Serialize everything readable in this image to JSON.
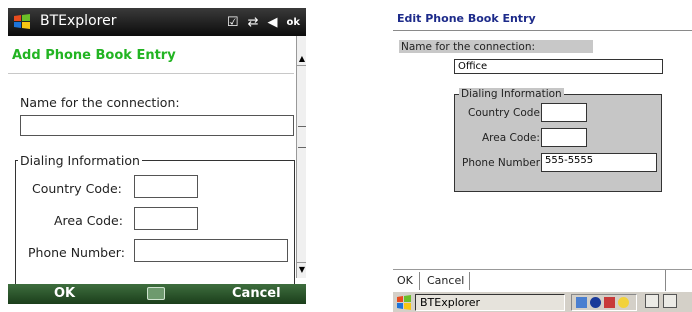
{
  "wm": {
    "title": "BTExplorer",
    "tray": {
      "ok": "ok"
    },
    "heading": "Add Phone Book Entry",
    "name_label": "Name for the connection:",
    "name_value": "",
    "group_legend": "Dialing Information",
    "country_label": "Country Code:",
    "country_value": "",
    "area_label": "Area Code:",
    "area_value": "",
    "phone_label": "Phone Number:",
    "phone_value": "",
    "softkeys": {
      "left": "OK",
      "right": "Cancel"
    }
  },
  "ce": {
    "title": "Edit Phone Book Entry",
    "name_label": "Name for the connection:",
    "name_value": "Office",
    "group_legend": "Dialing Information",
    "country_label": "Country Code:",
    "country_value": "",
    "area_label": "Area Code:",
    "area_value": "",
    "phone_label": "Phone Number:",
    "phone_value": "555-5555",
    "menu": {
      "ok": "OK",
      "cancel": "Cancel"
    },
    "taskbar_app": "BTExplorer"
  },
  "colors": {
    "wm_heading": "#22b422",
    "wm_titlebar": "#111111",
    "wm_softbar": "#2f5a2f",
    "ce_title": "#1d2b8a",
    "ce_group": "#c6c6c6"
  }
}
